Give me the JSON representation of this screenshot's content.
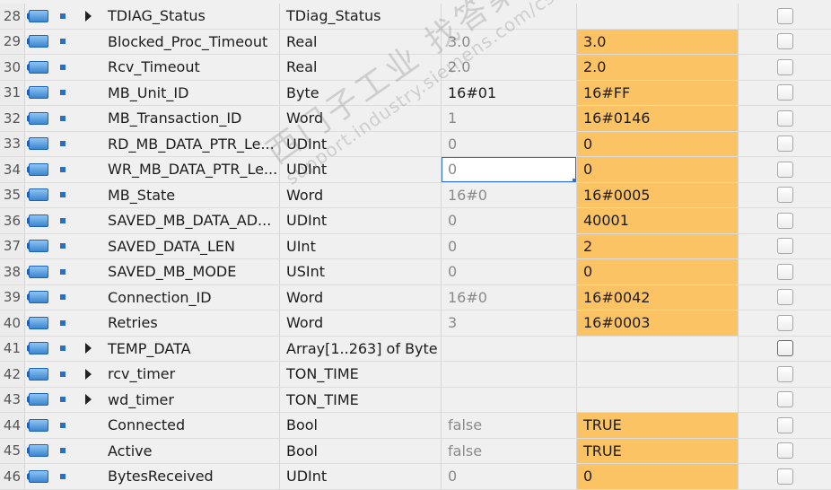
{
  "rows": [
    {
      "num": "28",
      "name": "TDIAG_Status",
      "type": "TDiag_Status",
      "start": "",
      "monitor": "",
      "expand": true
    },
    {
      "num": "29",
      "name": "Blocked_Proc_Timeout",
      "type": "Real",
      "start": "3.0",
      "monitor": "3.0",
      "hl": true
    },
    {
      "num": "30",
      "name": "Rcv_Timeout",
      "type": "Real",
      "start": "2.0",
      "monitor": "2.0",
      "hl": true
    },
    {
      "num": "31",
      "name": "MB_Unit_ID",
      "type": "Byte",
      "start": "16#01",
      "monitor": "16#FF",
      "hl": true,
      "dark": true
    },
    {
      "num": "32",
      "name": "MB_Transaction_ID",
      "type": "Word",
      "start": "1",
      "monitor": "16#0146",
      "hl": true
    },
    {
      "num": "33",
      "name": "RD_MB_DATA_PTR_Le...",
      "type": "UDInt",
      "start": "0",
      "monitor": "0",
      "hl": true
    },
    {
      "num": "34",
      "name": "WR_MB_DATA_PTR_Le...",
      "type": "UDInt",
      "start": "0",
      "monitor": "0",
      "hl": true,
      "selected": true
    },
    {
      "num": "35",
      "name": "MB_State",
      "type": "Word",
      "start": "16#0",
      "monitor": "16#0005",
      "hl": true
    },
    {
      "num": "36",
      "name": "SAVED_MB_DATA_AD...",
      "type": "UDInt",
      "start": "0",
      "monitor": "40001",
      "hl": true
    },
    {
      "num": "37",
      "name": "SAVED_DATA_LEN",
      "type": "UInt",
      "start": "0",
      "monitor": "2",
      "hl": true
    },
    {
      "num": "38",
      "name": "SAVED_MB_MODE",
      "type": "USInt",
      "start": "0",
      "monitor": "0",
      "hl": true
    },
    {
      "num": "39",
      "name": "Connection_ID",
      "type": "Word",
      "start": "16#0",
      "monitor": "16#0042",
      "hl": true
    },
    {
      "num": "40",
      "name": "Retries",
      "type": "Word",
      "start": "3",
      "monitor": "16#0003",
      "hl": true
    },
    {
      "num": "41",
      "name": "TEMP_DATA",
      "type": "Array[1..263] of Byte",
      "start": "",
      "monitor": "",
      "expand": true,
      "strongChk": true
    },
    {
      "num": "42",
      "name": "rcv_timer",
      "type": "TON_TIME",
      "start": "",
      "monitor": "",
      "expand": true
    },
    {
      "num": "43",
      "name": "wd_timer",
      "type": "TON_TIME",
      "start": "",
      "monitor": "",
      "expand": true
    },
    {
      "num": "44",
      "name": "Connected",
      "type": "Bool",
      "start": "false",
      "monitor": "TRUE",
      "hl": true
    },
    {
      "num": "45",
      "name": "Active",
      "type": "Bool",
      "start": "false",
      "monitor": "TRUE",
      "hl": true
    },
    {
      "num": "46",
      "name": "BytesReceived",
      "type": "UDInt",
      "start": "0",
      "monitor": "0",
      "hl": true
    }
  ],
  "icons": {
    "io": "input-output-icon",
    "square": "member-square-icon",
    "expand": "expand-triangle-icon"
  },
  "io_glyph": "◁▯",
  "colors": {
    "monitor_highlight": "#fbc363",
    "selection": "#2f6fd0"
  },
  "watermark": {
    "cn": "西门子工业",
    "cn2": "找答案",
    "url": "support.industry.siemens.com/cs"
  }
}
